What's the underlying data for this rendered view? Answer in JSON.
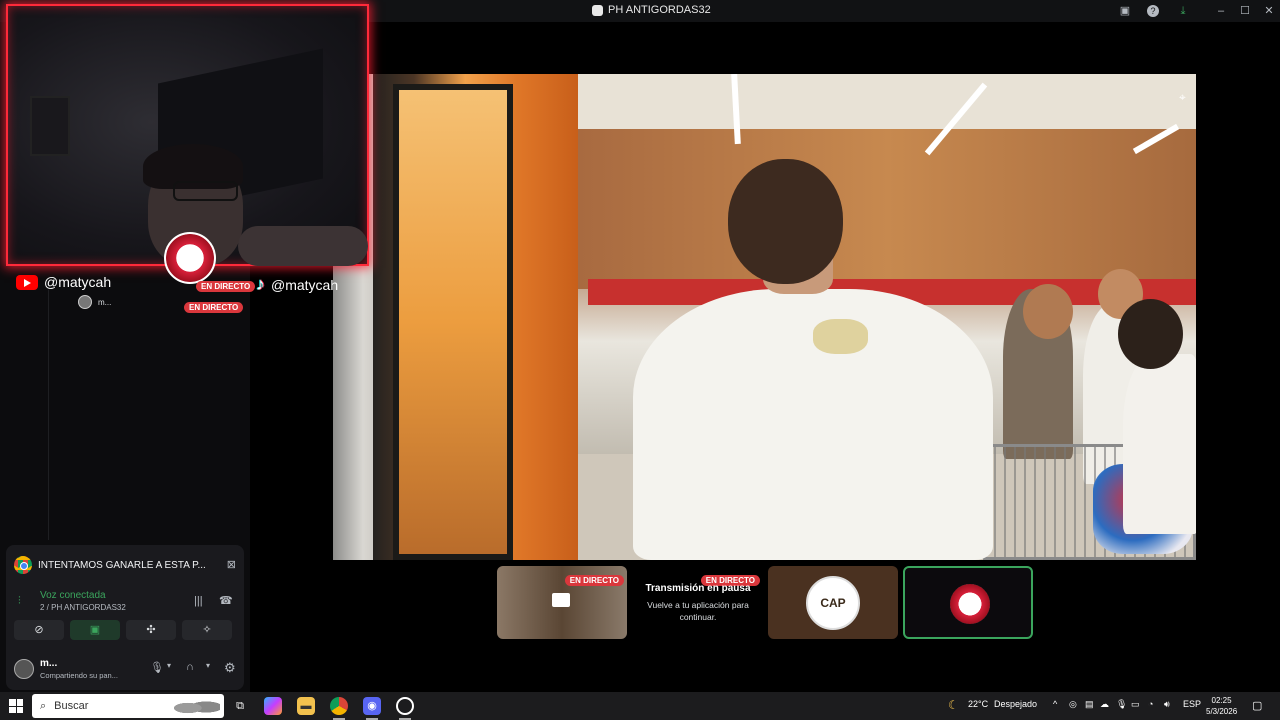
{
  "window": {
    "title": "PH ANTIGORDAS32"
  },
  "webcam": {
    "youtube_handle": "@matycah",
    "tiktok_handle": "@matycah",
    "live_badge_1": "EN DIRECTO",
    "live_badge_2": "EN DIRECTO",
    "participant_short": "m..."
  },
  "tiles": [
    {
      "badge": "EN DIRECTO"
    },
    {
      "badge": "EN DIRECTO",
      "title": "Transmisión en pausa",
      "subtitle": "Vuelve a tu aplicación para continuar."
    },
    {
      "label": "CAP"
    },
    {
      "selected": true
    }
  ],
  "voice_panel": {
    "activity_title": "INTENTAMOS GANARLE A ESTA P...",
    "status": "Voz conectada",
    "channel": "2 / PH ANTIGORDAS32",
    "user_name": "m...",
    "user_status": "Compartiendo su pan..."
  },
  "taskbar": {
    "search_placeholder": "Buscar",
    "weather_temp": "22°C",
    "weather_desc": "Despejado",
    "language": "ESP",
    "time": "02:25",
    "date": "5/3/2026"
  },
  "colors": {
    "accent_green": "#3ba55d",
    "live_red": "#da373c",
    "webcam_border": "#ff2a3a"
  }
}
